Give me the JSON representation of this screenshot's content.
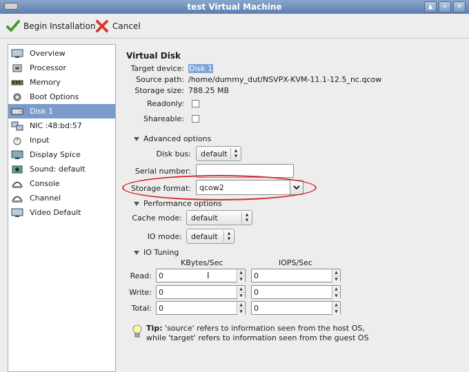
{
  "window": {
    "title": "test Virtual Machine",
    "buttons": [
      "▲",
      "+",
      "✕"
    ]
  },
  "toolbar": {
    "begin_label": "Begin Installation",
    "cancel_label": "Cancel"
  },
  "sidebar": {
    "items": [
      {
        "label": "Overview",
        "icon": "monitor-icon"
      },
      {
        "label": "Processor",
        "icon": "chip-icon"
      },
      {
        "label": "Memory",
        "icon": "memory-icon"
      },
      {
        "label": "Boot Options",
        "icon": "gear-icon"
      },
      {
        "label": "Disk 1",
        "icon": "disk-icon",
        "selected": true
      },
      {
        "label": "NIC :48:bd:57",
        "icon": "network-icon"
      },
      {
        "label": "Input",
        "icon": "mouse-icon"
      },
      {
        "label": "Display Spice",
        "icon": "display-icon"
      },
      {
        "label": "Sound: default",
        "icon": "sound-icon"
      },
      {
        "label": "Console",
        "icon": "console-icon"
      },
      {
        "label": "Channel",
        "icon": "channel-icon"
      },
      {
        "label": "Video Default",
        "icon": "video-icon"
      }
    ]
  },
  "disk": {
    "section_title": "Virtual Disk",
    "target_device_label": "Target device:",
    "target_device_value": "Disk 1",
    "source_path_label": "Source path:",
    "source_path_value": "/home/dummy_dut/NSVPX-KVM-11.1-12.5_nc.qcow",
    "storage_size_label": "Storage size:",
    "storage_size_value": "788.25 MB",
    "readonly_label": "Readonly:",
    "shareable_label": "Shareable:"
  },
  "advanced": {
    "title": "Advanced options",
    "disk_bus_label": "Disk bus:",
    "disk_bus_value": "default",
    "serial_label": "Serial number:",
    "serial_value": "",
    "storage_format_label": "Storage format:",
    "storage_format_value": "qcow2"
  },
  "performance": {
    "title": "Performance options",
    "cache_label": "Cache mode:",
    "cache_value": "default",
    "io_label": "IO mode:",
    "io_value": "default"
  },
  "io_tuning": {
    "title": "IO Tuning",
    "col_kbytes": "KBytes/Sec",
    "col_iops": "IOPS/Sec",
    "rows": [
      {
        "label": "Read:",
        "kbytes": "0",
        "iops": "0"
      },
      {
        "label": "Write:",
        "kbytes": "0",
        "iops": "0"
      },
      {
        "label": "Total:",
        "kbytes": "0",
        "iops": "0"
      }
    ]
  },
  "tip": {
    "bold": "Tip:",
    "line1": "'source' refers to information seen from the host OS,",
    "line2": "while 'target' refers to information seen from the guest OS"
  },
  "colors": {
    "annotation": "#d6272b",
    "selection": "#7a9bcc"
  }
}
